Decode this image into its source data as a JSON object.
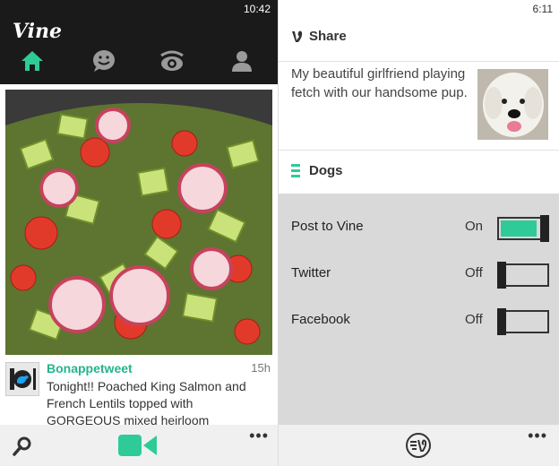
{
  "left": {
    "status_time": "10:42",
    "app_title": "Vine",
    "nav_tabs": [
      {
        "name": "home-icon",
        "active": true
      },
      {
        "name": "activity-icon",
        "active": false
      },
      {
        "name": "explore-icon",
        "active": false
      },
      {
        "name": "profile-icon",
        "active": false
      }
    ],
    "post": {
      "author": "Bonappetweet",
      "age": "15h",
      "caption": "Tonight!! Poached King Salmon and French Lentils topped with GORGEOUS mixed heirloom"
    },
    "appbar": {
      "more": "•••"
    }
  },
  "right": {
    "status_time": "6:11",
    "share_title": "Share",
    "description": "My beautiful girlfriend playing fetch with our handsome pup.",
    "channel": "Dogs",
    "settings": [
      {
        "label": "Post to Vine",
        "state": "On",
        "on": true
      },
      {
        "label": "Twitter",
        "state": "Off",
        "on": false
      },
      {
        "label": "Facebook",
        "state": "Off",
        "on": false
      }
    ],
    "appbar": {
      "more": "•••"
    }
  },
  "colors": {
    "accent": "#2ecb98",
    "dark": "#1a1a1a",
    "settings_bg": "#d9d9d9"
  }
}
